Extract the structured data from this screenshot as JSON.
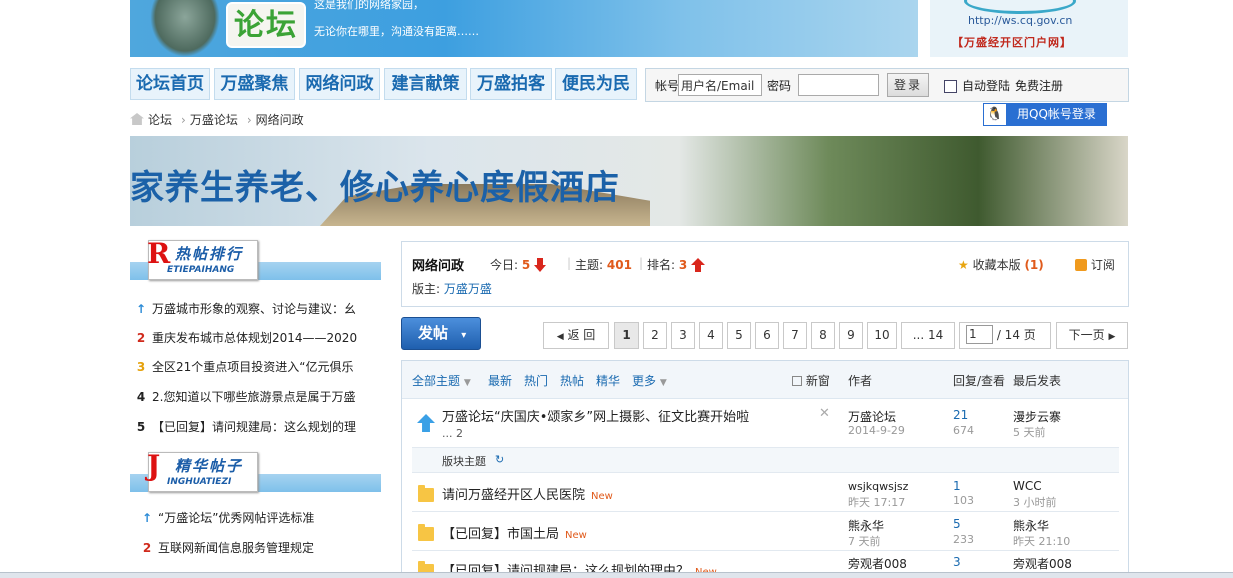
{
  "banner": {
    "logo_text": "论坛",
    "tagline1": "这是我们的网络家园，",
    "tagline2": "无论你在哪里，沟通没有距离……"
  },
  "portal": {
    "url": "http://ws.cq.gov.cn",
    "name": "【万盛经开区门户网】"
  },
  "nav": {
    "tabs": [
      "论坛首页",
      "万盛聚焦",
      "网络问政",
      "建言献策",
      "万盛拍客",
      "便民为民"
    ]
  },
  "login": {
    "account_label": "帐号",
    "username_value": "用户名/Email",
    "password_label": "密码",
    "login_button": "登录",
    "auto_login": "自动登陆",
    "register": "免费注册",
    "qq_login": "用QQ帐号登录"
  },
  "breadcrumb": [
    "论坛",
    "万盛论坛",
    "网络问政"
  ],
  "ad": {
    "text": "家养生养老、修心养心度假酒店"
  },
  "sidebar": {
    "hot": {
      "title_zh": "热帖排行",
      "title_en": "ETIEPAIHANG",
      "title_initial": "R",
      "items": [
        {
          "icon": "↑",
          "text": "万盛城市形象的观察、讨论与建议：幺"
        },
        {
          "icon": "2",
          "text": "重庆发布城市总体规划2014——2020"
        },
        {
          "icon": "3",
          "text": "全区21个重点项目投资进入“亿元俱乐"
        },
        {
          "icon": "4",
          "text": "2.您知道以下哪些旅游景点是属于万盛"
        },
        {
          "icon": "5",
          "text": "【已回复】请问规建局：这么规划的理"
        }
      ]
    },
    "featured": {
      "title_zh": "精华帖子",
      "title_en": "INGHUATIEZI",
      "title_initial": "J",
      "items": [
        {
          "icon": "↑",
          "text": "“万盛论坛”优秀网帖评选标准"
        },
        {
          "icon": "2",
          "text": "互联网新闻信息服务管理规定"
        }
      ]
    }
  },
  "forum": {
    "name": "网络问政",
    "today_label": "今日:",
    "today": "5",
    "topics_label": "主题:",
    "topics": "401",
    "rank_label": "排名:",
    "rank": "3",
    "favorite": "收藏本版",
    "favorite_count": "(1)",
    "subscribe": "订阅",
    "moderator_label": "版主:",
    "moderator": "万盛万盛"
  },
  "actions": {
    "post": "发帖",
    "back": "返 回",
    "pages": [
      "1",
      "2",
      "3",
      "4",
      "5",
      "6",
      "7",
      "8",
      "9",
      "10"
    ],
    "last": "... 14",
    "page_input": "1",
    "page_total": "/ 14 页",
    "next": "下一页"
  },
  "filters": {
    "items": [
      "全部主题",
      "最新",
      "热门",
      "热帖",
      "精华",
      "更多"
    ],
    "new_window": "新窗",
    "col_author": "作者",
    "col_reply": "回复/查看",
    "col_last": "最后发表"
  },
  "threads": {
    "sticky": {
      "title": "万盛论坛“庆国庆•颂家乡”网上摄影、征文比赛开始啦",
      "pages": "... 2",
      "author": "万盛论坛",
      "date": "2014-9-29",
      "replies": "21",
      "views": "674",
      "last_user": "漫步云寨",
      "last_time": "5 天前"
    },
    "section_label": "版块主题",
    "rows": [
      {
        "title": "请问万盛经开区人民医院",
        "new": "New",
        "author": "wsjkqwsjsz",
        "date": "昨天 17:17",
        "replies": "1",
        "views": "103",
        "last_user": "WCC",
        "last_time": "3 小时前"
      },
      {
        "title": "【已回复】市国土局",
        "new": "New",
        "author": "熊永华",
        "date": "7 天前",
        "replies": "5",
        "views": "233",
        "last_user": "熊永华",
        "last_time": "昨天 21:10"
      },
      {
        "title": "【已回复】请问规建局：这么规划的理由？",
        "new": "New",
        "author": "旁观者008",
        "date": "",
        "replies": "3",
        "views": "",
        "last_user": "旁观者008",
        "last_time": ""
      }
    ]
  }
}
